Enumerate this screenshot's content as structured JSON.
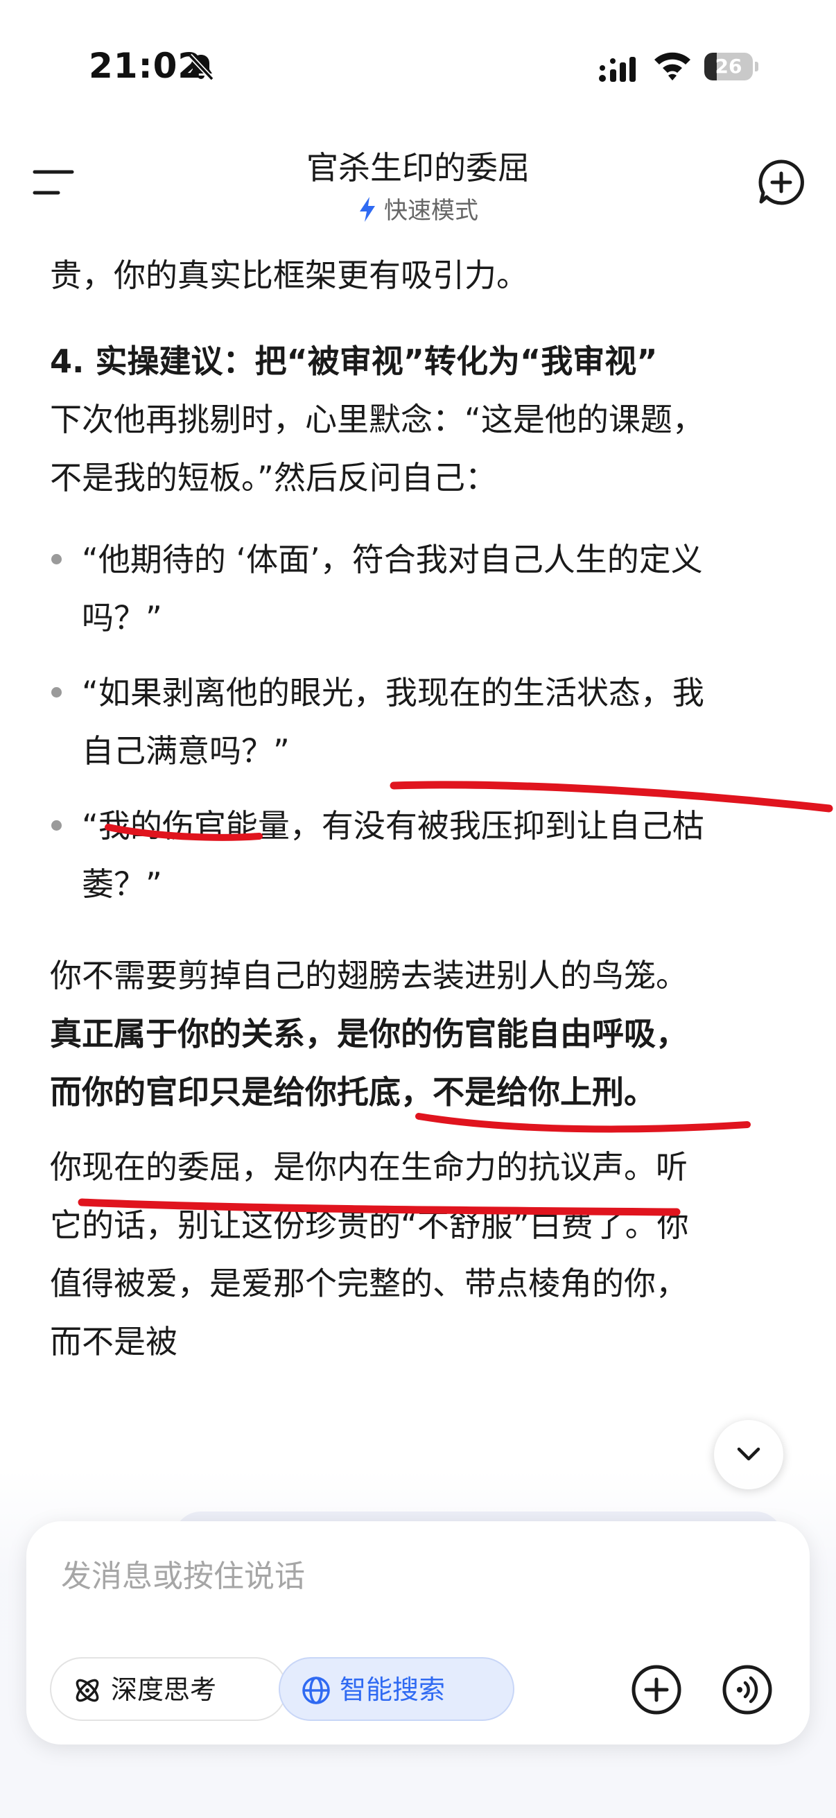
{
  "status_bar": {
    "time": "21:02",
    "battery": "26",
    "battery_level_percent": 26,
    "icons": [
      "bell-muted-icon",
      "signal-icon",
      "wifi-icon",
      "battery-icon"
    ]
  },
  "header": {
    "title": "官杀生印的委屈",
    "mode_label": "快速模式",
    "icons": [
      "menu-icon",
      "bolt-icon",
      "new-chat-icon"
    ],
    "accent_color": "#2f6af2"
  },
  "content": {
    "para_top": "贵，你的真实比框架更有吸引力。",
    "section_heading": "4. 实操建议：把“被审视”转化为“我审视”",
    "section_line1": "下次他再挑剔时，心里默念：“这是他的课题，",
    "section_line2": "不是我的短板。”然后反问自己：",
    "bullets": [
      {
        "line1": "“他期待的 ‘体面’，符合我对自己人生的定义",
        "line2": "吗？”"
      },
      {
        "line1": "“如果剥离他的眼光，我现在的生活状态，我",
        "line2": "自己满意吗？”"
      },
      {
        "line1": "“我的伤官能量，有没有被我压抑到让自己枯",
        "line2": "萎？”"
      }
    ],
    "para_cage": "你不需要剪掉自己的翅膀去装进别人的鸟笼。",
    "bold_line1": "真正属于你的关系，是你的伤官能自由呼吸，",
    "bold_line2": "而你的官印只是给你托底，不是给你上刑。",
    "final_line1": "你现在的委屈，是你内在生命力的抗议声。听",
    "final_line2": "它的话，别让这份珍贵的“不舒服”白费了。你",
    "final_line3": "值得被爱，是爱那个完整的、带点棱角的你，",
    "final_line4": "而不是被",
    "annotation_color": "#e0141e"
  },
  "composer": {
    "placeholder": "发消息或按住说话",
    "deep_think_label": "深度思考",
    "smart_search_label": "智能搜索",
    "icons": [
      "atom-icon",
      "globe-icon",
      "plus-icon",
      "voice-icon",
      "chevron-down-icon"
    ]
  }
}
